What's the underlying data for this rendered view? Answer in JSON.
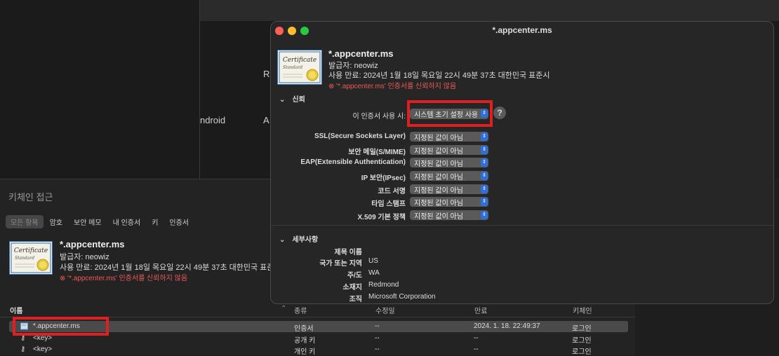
{
  "background": {
    "left_fragment": "ndroid",
    "right_fragment_1": "A",
    "right_fragment_2": "R"
  },
  "keychain": {
    "title": "키체인 접근",
    "tabs": [
      "모든 항목",
      "암호",
      "보안 메모",
      "내 인증서",
      "키",
      "인증서"
    ],
    "cert": {
      "name": "*.appcenter.ms",
      "issuer": "발급자: neowiz",
      "expiry": "사용 만료: 2024년 1월 18일 목요일 22시 49분 37초 대한민국 표준시",
      "warning": "'*.appcenter.ms' 인증서를 신뢰하지 않음"
    },
    "columns": [
      "이름",
      "종류",
      "수정일",
      "만료",
      "키체인"
    ],
    "rows": [
      {
        "name": "*.appcenter.ms",
        "kind": "인증서",
        "modified": "--",
        "expires": "2024. 1. 18. 22:49:37",
        "keychain": "로그인"
      },
      {
        "name": "<key>",
        "kind": "공개 키",
        "modified": "--",
        "expires": "--",
        "keychain": "로그인"
      },
      {
        "name": "<key>",
        "kind": "개인 키",
        "modified": "--",
        "expires": "--",
        "keychain": "로그인"
      }
    ]
  },
  "panel": {
    "title": "*.appcenter.ms",
    "cert": {
      "name": "*.appcenter.ms",
      "issuer": "발급자: neowiz",
      "expiry": "사용 만료: 2024년 1월 18일 목요일 22시 49분 37초 대한민국 표준시",
      "warning": "'*.appcenter.ms' 인증서를 신뢰하지 않음"
    },
    "trust_section": "신뢰",
    "when_using_label": "이 인증서 사용 시:",
    "when_using_value": "시스템 초기 설정 사용",
    "help_label": "?",
    "policies": [
      {
        "label": "SSL(Secure Sockets Layer)",
        "value": "지정된 값이 아님"
      },
      {
        "label": "보안 메일(S/MIME)",
        "value": "지정된 값이 아님"
      },
      {
        "label": "EAP(Extensible Authentication)",
        "value": "지정된 값이 아님"
      },
      {
        "label": "IP 보안(IPsec)",
        "value": "지정된 값이 아님"
      },
      {
        "label": "코드 서명",
        "value": "지정된 값이 아님"
      },
      {
        "label": "타임 스탬프",
        "value": "지정된 값이 아님"
      },
      {
        "label": "X.509 기본 정책",
        "value": "지정된 값이 아님"
      }
    ],
    "details_section": "세부사항",
    "subject_name_label": "제목 이름",
    "details": [
      {
        "label": "국가 또는 지역",
        "value": "US"
      },
      {
        "label": "주/도",
        "value": "WA"
      },
      {
        "label": "소재지",
        "value": "Redmond"
      },
      {
        "label": "조직",
        "value": "Microsoft Corporation"
      }
    ]
  },
  "colors": {
    "warning": "#ee5a5a",
    "highlight_box": "#e02020",
    "accent": "#2f6fdd"
  }
}
